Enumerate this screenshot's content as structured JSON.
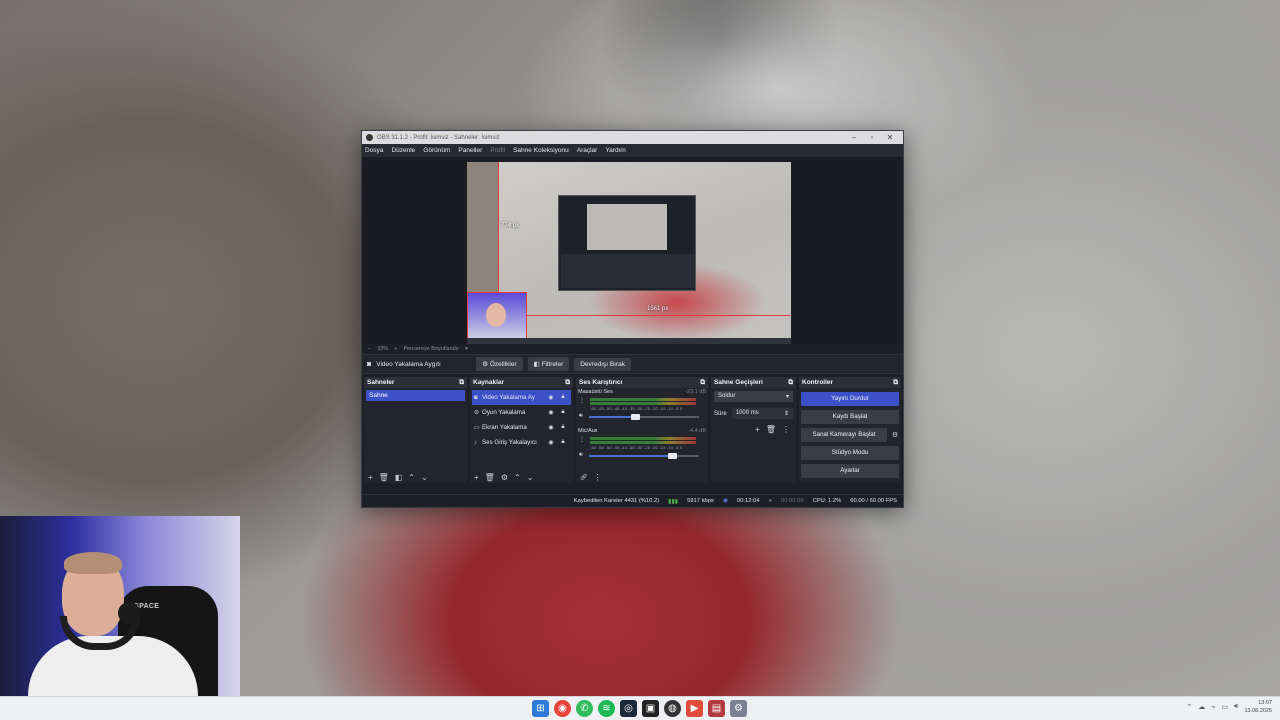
{
  "obs": {
    "title": "OBS 31.1.2 - Profil: İsimsiz - Sahneler: İsimsiz",
    "menu": [
      "Dosya",
      "Düzenle",
      "Görünüm",
      "Paneller",
      "Profil",
      "Sahne Koleksiyonu",
      "Araçlar",
      "Yardım"
    ],
    "preview": {
      "height_label": "774 px",
      "width_label": "1561 px",
      "zoom": "33%",
      "fit_label": "Pencereye Boyutlandır"
    },
    "source_toolbar": {
      "selected_source": "Video Yakalama Aygıtı",
      "properties": "Özellikler",
      "filters": "Filtreler",
      "deactivate": "Devredışı Bırak"
    },
    "scenes": {
      "title": "Sahneler",
      "items": [
        "Sahne"
      ]
    },
    "sources": {
      "title": "Kaynaklar",
      "items": [
        "Video Yakalama Ay",
        "Oyun Yakalama",
        "Ekran Yakalama",
        "Ses Giriş Yakalayıcı"
      ]
    },
    "mixer": {
      "title": "Ses Karıştırıcı",
      "ticks": "-60 -55 -50 -45 -40 -35 -30 -25 -20 -15 -10 -5 0",
      "channels": [
        {
          "name": "Masaüstü Ses",
          "db": "-23.1 dB",
          "volume": 0.42
        },
        {
          "name": "Mic/Aux",
          "db": "-4.4 dB",
          "volume": 0.75
        }
      ]
    },
    "transitions": {
      "title": "Sahne Geçişleri",
      "selected": "Soldur",
      "duration_label": "Süre",
      "duration_value": "1000 ms"
    },
    "controls": {
      "title": "Kontroller",
      "stop_stream": "Yayını Durdur",
      "start_recording": "Kaydı Başlat",
      "virtual_camera": "Sanal Kamerayı Başlat",
      "studio_mode": "Stüdyo Modu",
      "settings": "Ayarlar"
    },
    "status": {
      "dropped_frames": "Kaybedilen Kareler 4431 (%10.2)",
      "bitrate": "5917 kbps",
      "stream_time": "00:12:04",
      "rec_time": "00:00:00",
      "cpu": "CPU: 1.2%",
      "fps": "60.00 / 60.00 FPS"
    }
  },
  "webcam": {
    "chair_brand": "MSPACE"
  },
  "taskbar": {
    "time": "13:07",
    "date": "13.08.2025"
  },
  "colors": {
    "accent": "#3c50c8",
    "panel": "#23252d",
    "window_bg": "#1d1f26"
  }
}
